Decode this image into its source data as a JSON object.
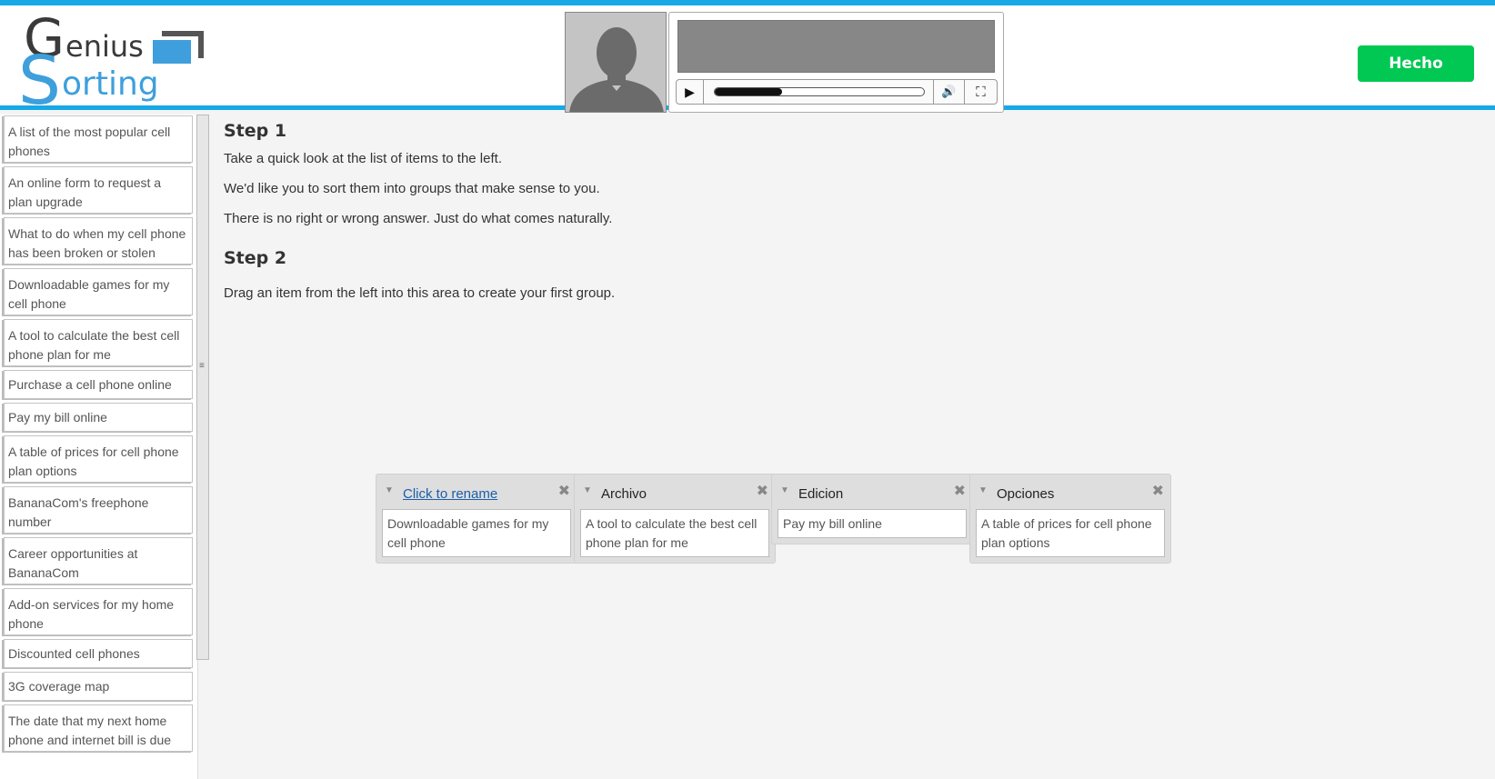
{
  "header": {
    "logo_genius": "Genius",
    "logo_sorting": "Sorting",
    "done_label": "Hecho",
    "player": {
      "progress": 0.32
    }
  },
  "sidebar": {
    "items": [
      {
        "label": "A list of the most popular cell phones"
      },
      {
        "label": "An online form to request a plan upgrade"
      },
      {
        "label": "What to do when my cell phone has been broken or stolen"
      },
      {
        "label": "Downloadable games for my cell phone"
      },
      {
        "label": "A tool to calculate the best cell phone plan for me"
      },
      {
        "label": "Purchase a cell phone online"
      },
      {
        "label": "Pay my bill online"
      },
      {
        "label": "A table of prices for cell phone plan options"
      },
      {
        "label": "BananaCom's freephone number"
      },
      {
        "label": "Career opportunities at BananaCom"
      },
      {
        "label": "Add-on services for my home phone"
      },
      {
        "label": "Discounted cell phones"
      },
      {
        "label": "3G coverage map"
      },
      {
        "label": "The date that my next home phone and internet bill is due"
      }
    ]
  },
  "main": {
    "step1": {
      "title": "Step 1",
      "lines": [
        "Take a quick look at the list of items to the left.",
        "We'd like you to sort them into groups that make sense to you.",
        "There is no right or wrong answer. Just do what comes naturally."
      ]
    },
    "step2": {
      "title": "Step 2",
      "lines": [
        "Drag an item from the left into this area to create your first group."
      ]
    },
    "groups": [
      {
        "title": "Click to rename",
        "card": "Downloadable games for my cell phone"
      },
      {
        "title": "Archivo",
        "card": "A tool to calculate the best cell phone plan for me"
      },
      {
        "title": "Edicion",
        "card": "Pay my bill online"
      },
      {
        "title": "Opciones",
        "card": "A table of prices for cell phone plan options"
      }
    ]
  },
  "icons": {
    "play": "play-icon",
    "volume": "volume-icon",
    "fullscreen": "fullscreen-icon",
    "close": "close-icon",
    "caret": "caret-down-icon"
  },
  "colors": {
    "accent": "#16a9e6",
    "done": "#00c853",
    "link": "#1b5eaa"
  }
}
